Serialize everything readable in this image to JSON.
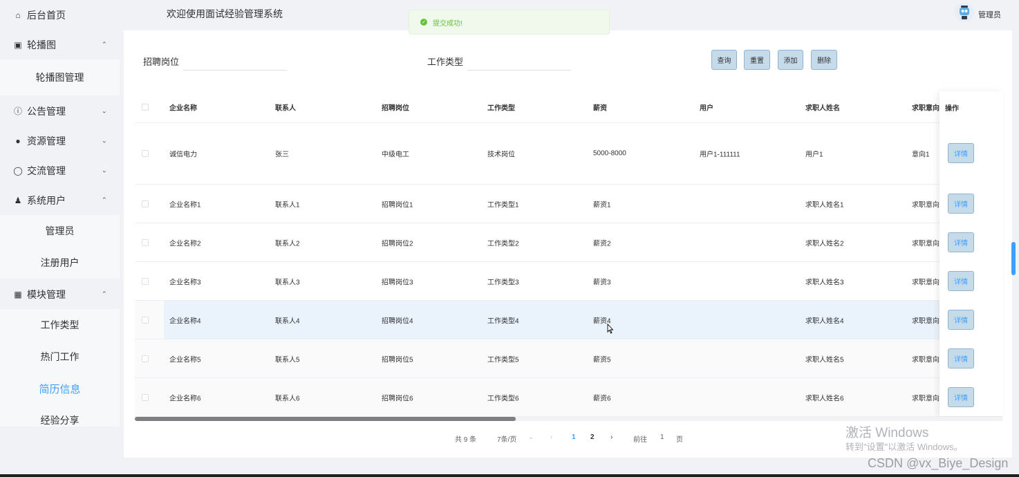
{
  "sidebar": {
    "home": "后台首页",
    "carousel": "轮播图",
    "carousel_sub": [
      "轮播图管理"
    ],
    "notice": "公告管理",
    "resource": "资源管理",
    "exchange": "交流管理",
    "sys_user": "系统用户",
    "sys_user_sub": [
      "管理员",
      "注册用户"
    ],
    "module": "模块管理",
    "module_sub": [
      "工作类型",
      "热门工作",
      "简历信息",
      "经验分享"
    ],
    "active_item": "简历信息"
  },
  "header": {
    "title": "欢迎使用面试经验管理系统",
    "user": "管理员"
  },
  "toast": {
    "message": "提交成功!"
  },
  "search": {
    "field1_label": "招聘岗位",
    "field2_label": "工作类型",
    "buttons": [
      "查询",
      "重置",
      "添加",
      "删除"
    ]
  },
  "table": {
    "headers": [
      "企业名称",
      "联系人",
      "招聘岗位",
      "工作类型",
      "薪资",
      "用户",
      "求职人姓名",
      "求职意向"
    ],
    "op_header": "操作",
    "detail_label": "详情",
    "rows": [
      [
        "诚信电力",
        "张三",
        "中级电工",
        "技术岗位",
        "5000-8000",
        "用户1-111111",
        "用户1",
        "意向1"
      ],
      [
        "企业名称1",
        "联系人1",
        "招聘岗位1",
        "工作类型1",
        "薪资1",
        "",
        "求职人姓名1",
        "求职意向"
      ],
      [
        "企业名称2",
        "联系人2",
        "招聘岗位2",
        "工作类型2",
        "薪资2",
        "",
        "求职人姓名2",
        "求职意向"
      ],
      [
        "企业名称3",
        "联系人3",
        "招聘岗位3",
        "工作类型3",
        "薪资3",
        "",
        "求职人姓名3",
        "求职意向"
      ],
      [
        "企业名称4",
        "联系人4",
        "招聘岗位4",
        "工作类型4",
        "薪资4",
        "",
        "求职人姓名4",
        "求职意向"
      ],
      [
        "企业名称5",
        "联系人5",
        "招聘岗位5",
        "工作类型5",
        "薪资5",
        "",
        "求职人姓名5",
        "求职意向"
      ],
      [
        "企业名称6",
        "联系人6",
        "招聘岗位6",
        "工作类型6",
        "薪资6",
        "",
        "求职人姓名6",
        "求职意向"
      ]
    ]
  },
  "pagination": {
    "total": "共 9 条",
    "page_size": "7条/页",
    "page1": "1",
    "page2": "2",
    "goto": "前往",
    "goto_value": "1",
    "page_unit": "页"
  },
  "overlay": {
    "watermark_title": "激活 Windows",
    "watermark_sub": "转到\"设置\"以激活 Windows。",
    "csdn": "CSDN @vx_Biye_Design"
  }
}
